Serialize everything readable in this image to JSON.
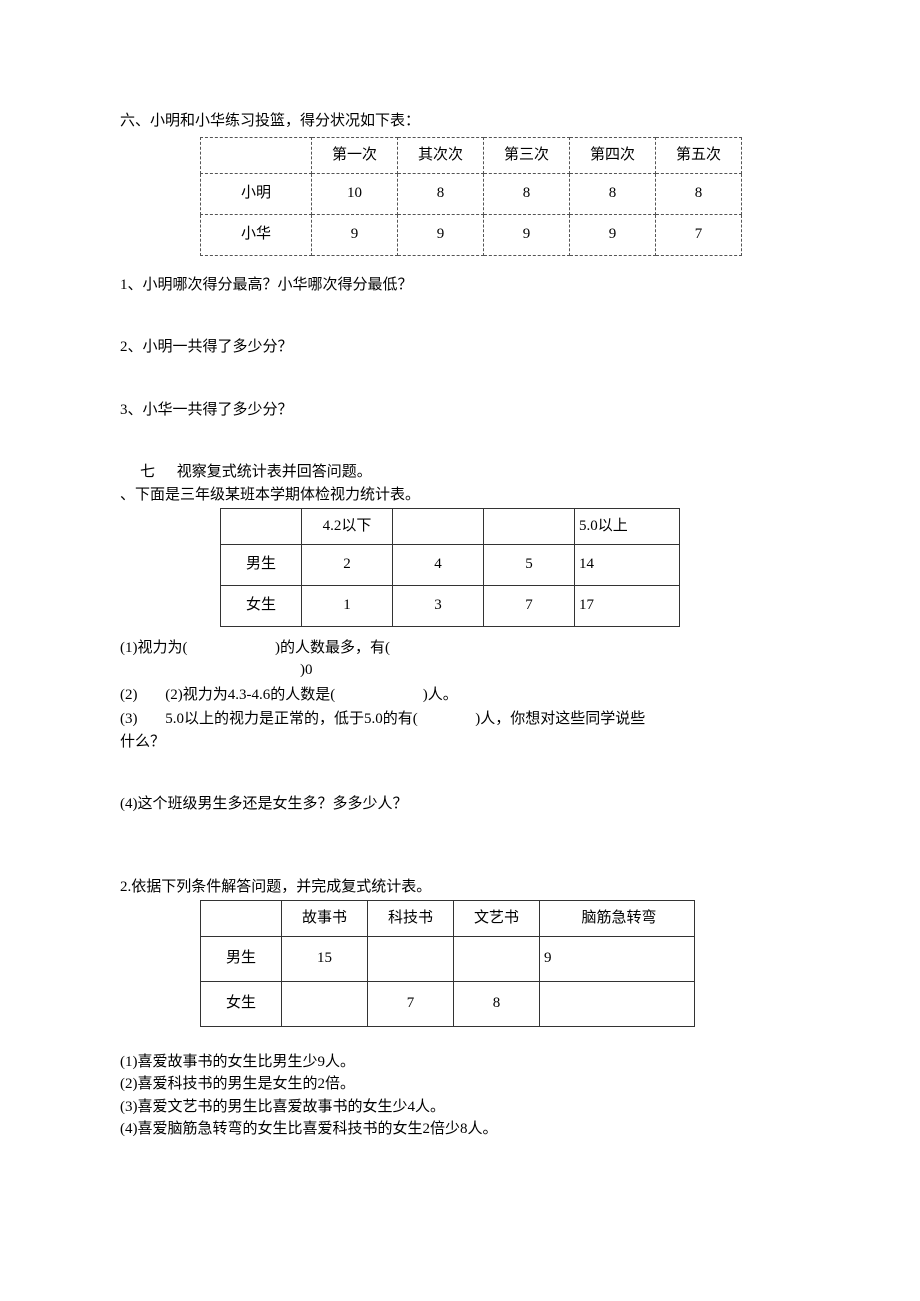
{
  "section6": {
    "title": "六、小明和小华练习投篮，得分状况如下表：",
    "headers": [
      "",
      "第一次",
      "其次次",
      "第三次",
      "第四次",
      "第五次"
    ],
    "rows": [
      {
        "name": "小明",
        "vals": [
          "10",
          "8",
          "8",
          "8",
          "8"
        ]
      },
      {
        "name": "小华",
        "vals": [
          "9",
          "9",
          "9",
          "9",
          "7"
        ]
      }
    ],
    "q1": "1、小明哪次得分最高？小华哪次得分最低？",
    "q2": "2、小明一共得了多少分？",
    "q3": "3、小华一共得了多少分？"
  },
  "section7": {
    "title_a": "七",
    "title_b": "视察复式统计表并回答问题。",
    "sub1": "、下面是三年级某班本学期体检视力统计表。",
    "t2_headers": [
      "",
      "4.2以下",
      "",
      "",
      "5.0以上"
    ],
    "t2_rows": [
      {
        "name": "男生",
        "vals": [
          "2",
          "4",
          "5",
          "14"
        ]
      },
      {
        "name": "女生",
        "vals": [
          "1",
          "3",
          "7",
          "17"
        ]
      }
    ],
    "q1_a": "(1)视力为(",
    "q1_b": ")的人数最多，有(",
    "q1_c": ")0",
    "q2_a": "(2)",
    "q2_b": "(2)视力为4.3-4.6的人数是(",
    "q2_c": ")人。",
    "q3_a": "(3)",
    "q3_b": "5.0以上的视力是正常的，低于5.0的有(",
    "q3_c": ")人，你想对这些同学说些",
    "q3_d": "什么？",
    "q4": "(4)这个班级男生多还是女生多？多多少人？"
  },
  "section7b": {
    "title": "2.依据下列条件解答问题，并完成复式统计表。",
    "headers": [
      "",
      "故事书",
      "科技书",
      "文艺书",
      "脑筋急转弯"
    ],
    "rows": [
      {
        "name": "男生",
        "vals": [
          "15",
          "",
          "",
          "9"
        ]
      },
      {
        "name": "女生",
        "vals": [
          "",
          "7",
          "8",
          ""
        ]
      }
    ],
    "c1": "(1)喜爱故事书的女生比男生少9人。",
    "c2": "(2)喜爱科技书的男生是女生的2倍。",
    "c3": "(3)喜爱文艺书的男生比喜爱故事书的女生少4人。",
    "c4": "(4)喜爱脑筋急转弯的女生比喜爱科技书的女生2倍少8人。"
  }
}
